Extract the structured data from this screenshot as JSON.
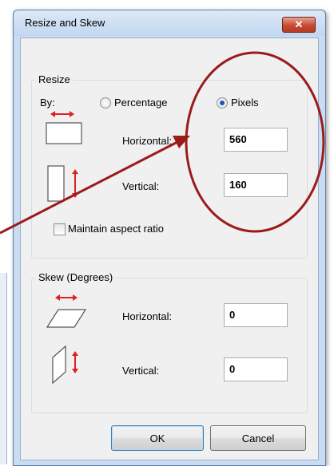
{
  "window": {
    "title": "Resize and Skew",
    "close_label": "✕"
  },
  "resize": {
    "group_title": "Resize",
    "by_label": "By:",
    "percentage_label": "Percentage",
    "pixels_label": "Pixels",
    "horizontal_label": "Horizontal:",
    "horizontal_value": "560",
    "vertical_label": "Vertical:",
    "vertical_value": "160",
    "maintain_aspect_label": "Maintain aspect ratio",
    "selected_unit": "Pixels",
    "maintain_aspect_checked": false
  },
  "skew": {
    "group_title": "Skew (Degrees)",
    "horizontal_label": "Horizontal:",
    "horizontal_value": "0",
    "vertical_label": "Vertical:",
    "vertical_value": "0"
  },
  "buttons": {
    "ok_label": "OK",
    "cancel_label": "Cancel"
  },
  "colors": {
    "annotation": "#9b1b1b",
    "icon_arrow": "#e02020"
  }
}
